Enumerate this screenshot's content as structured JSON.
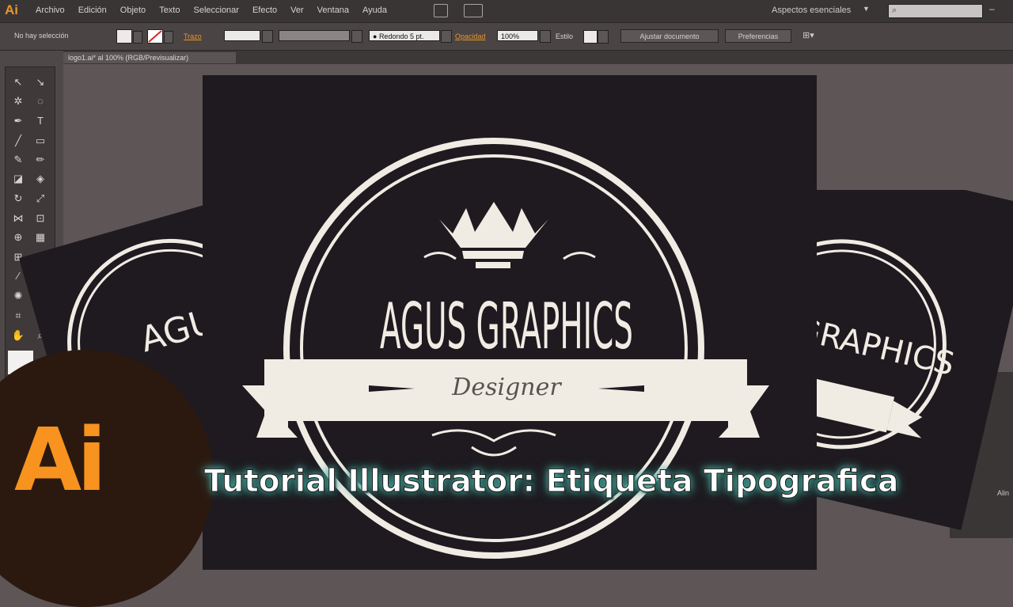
{
  "app": {
    "logo": "Ai",
    "menu": [
      "Archivo",
      "Edición",
      "Objeto",
      "Texto",
      "Seleccionar",
      "Efecto",
      "Ver",
      "Ventana",
      "Ayuda"
    ],
    "workspace": "Aspectos esenciales",
    "search_placeholder": ""
  },
  "control_bar": {
    "selection": "No hay selección",
    "stroke_label": "Trazo",
    "brush": "Redondo 5 pt.",
    "opacity_label": "Opacidad",
    "opacity_value": "100%",
    "style_label": "Estilo",
    "fit_button": "Ajustar documento",
    "prefs_button": "Preferencias"
  },
  "document": {
    "tab": "logo1.ai* al 100% (RGB/Previsualizar)"
  },
  "artwork": {
    "brand": "AGUS GRAPHICS",
    "brand_partial": "GRAPHICS",
    "left_partial": "AGU",
    "ribbon_text": "Designer"
  },
  "panel": {
    "align_label": "Alin"
  },
  "overlay": {
    "title": "Tutorial Illustrator: Etiqueta Tipografica",
    "badge": "Ai"
  },
  "colors": {
    "brand_orange": "#f7931e",
    "badge_bg": "#2b1910",
    "art_bg": "#1e1a1f",
    "art_fg": "#f0ece4",
    "title_glow": "#4fb0a5"
  }
}
